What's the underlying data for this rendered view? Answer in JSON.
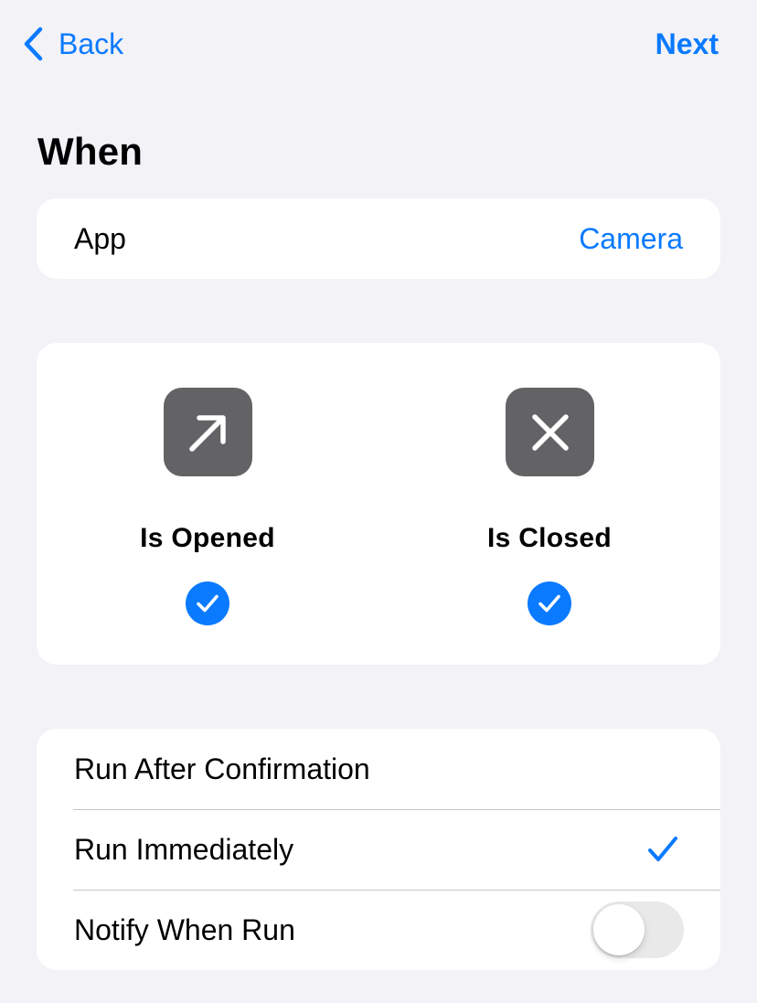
{
  "nav": {
    "back_label": "Back",
    "next_label": "Next"
  },
  "section": {
    "title": "When"
  },
  "app_row": {
    "label": "App",
    "value": "Camera"
  },
  "options": [
    {
      "label": "Is Opened",
      "icon": "arrow-up-right-icon",
      "checked": true
    },
    {
      "label": "Is Closed",
      "icon": "xmark-icon",
      "checked": true
    }
  ],
  "run_options": [
    {
      "label": "Run After Confirmation",
      "selected": false
    },
    {
      "label": "Run Immediately",
      "selected": true
    },
    {
      "label": "Notify When Run",
      "toggle_on": false
    }
  ],
  "colors": {
    "accent": "#0a7aff",
    "background": "#f2f2f7",
    "icon_tile": "#636366",
    "toggle_off": "#e9e9ea"
  }
}
